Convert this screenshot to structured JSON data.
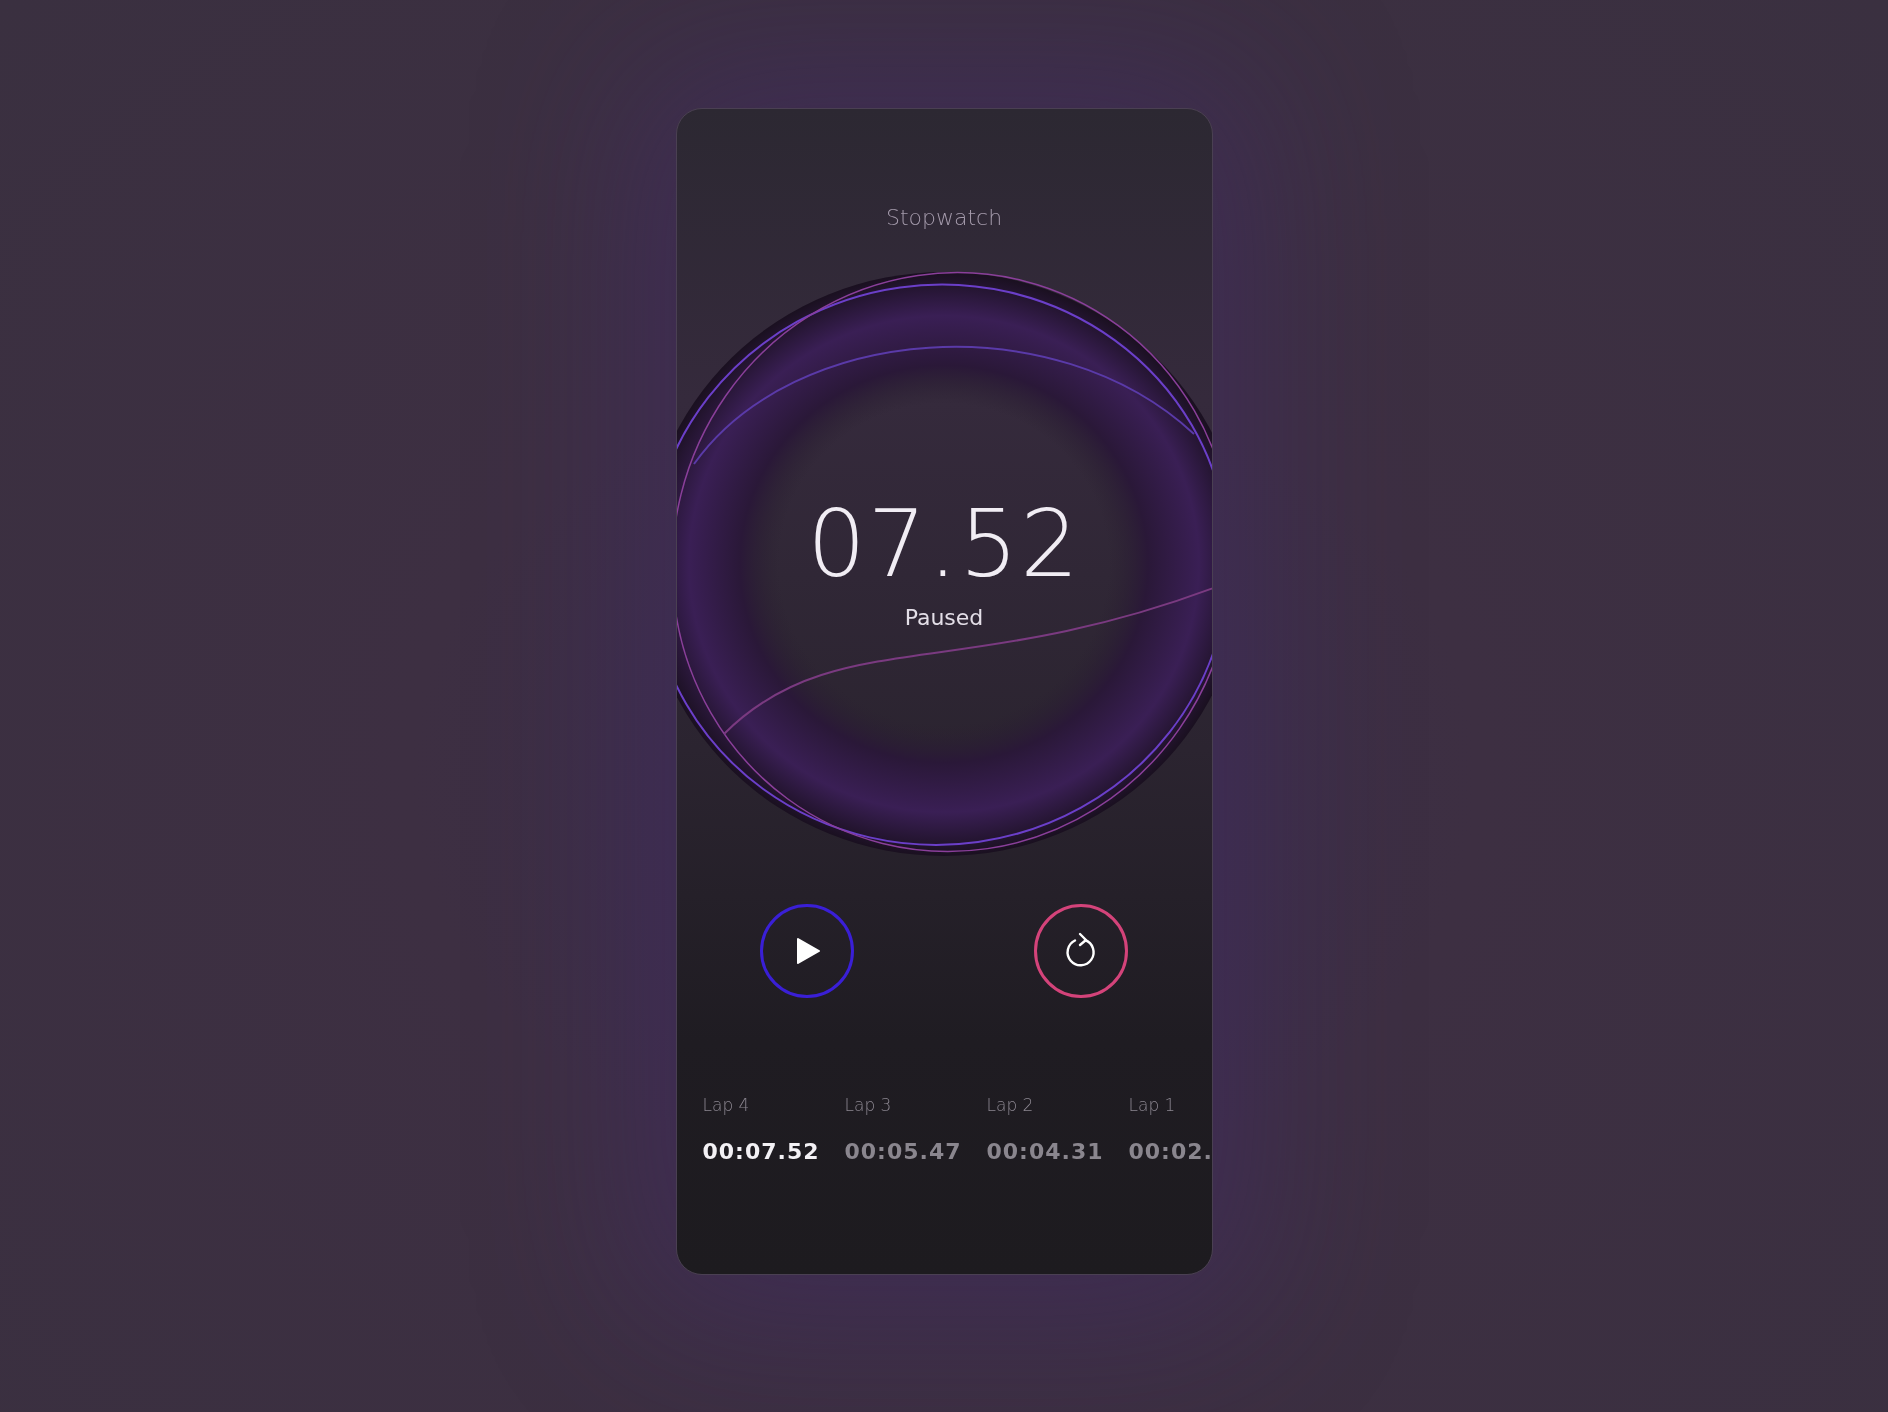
{
  "title": "Stopwatch",
  "time": "07.52",
  "status": "Paused",
  "buttons": [
    {
      "kind": "play",
      "color": "#3a1fd6"
    },
    {
      "kind": "reset",
      "color": "#d4437a"
    }
  ],
  "laps": [
    {
      "label": "Lap 4",
      "time": "00:07.52",
      "selected": true
    },
    {
      "label": "Lap 3",
      "time": "00:05.47",
      "selected": false
    },
    {
      "label": "Lap 2",
      "time": "00:04.31",
      "selected": false
    },
    {
      "label": "Lap 1",
      "time": "00:02.",
      "selected": false
    }
  ]
}
